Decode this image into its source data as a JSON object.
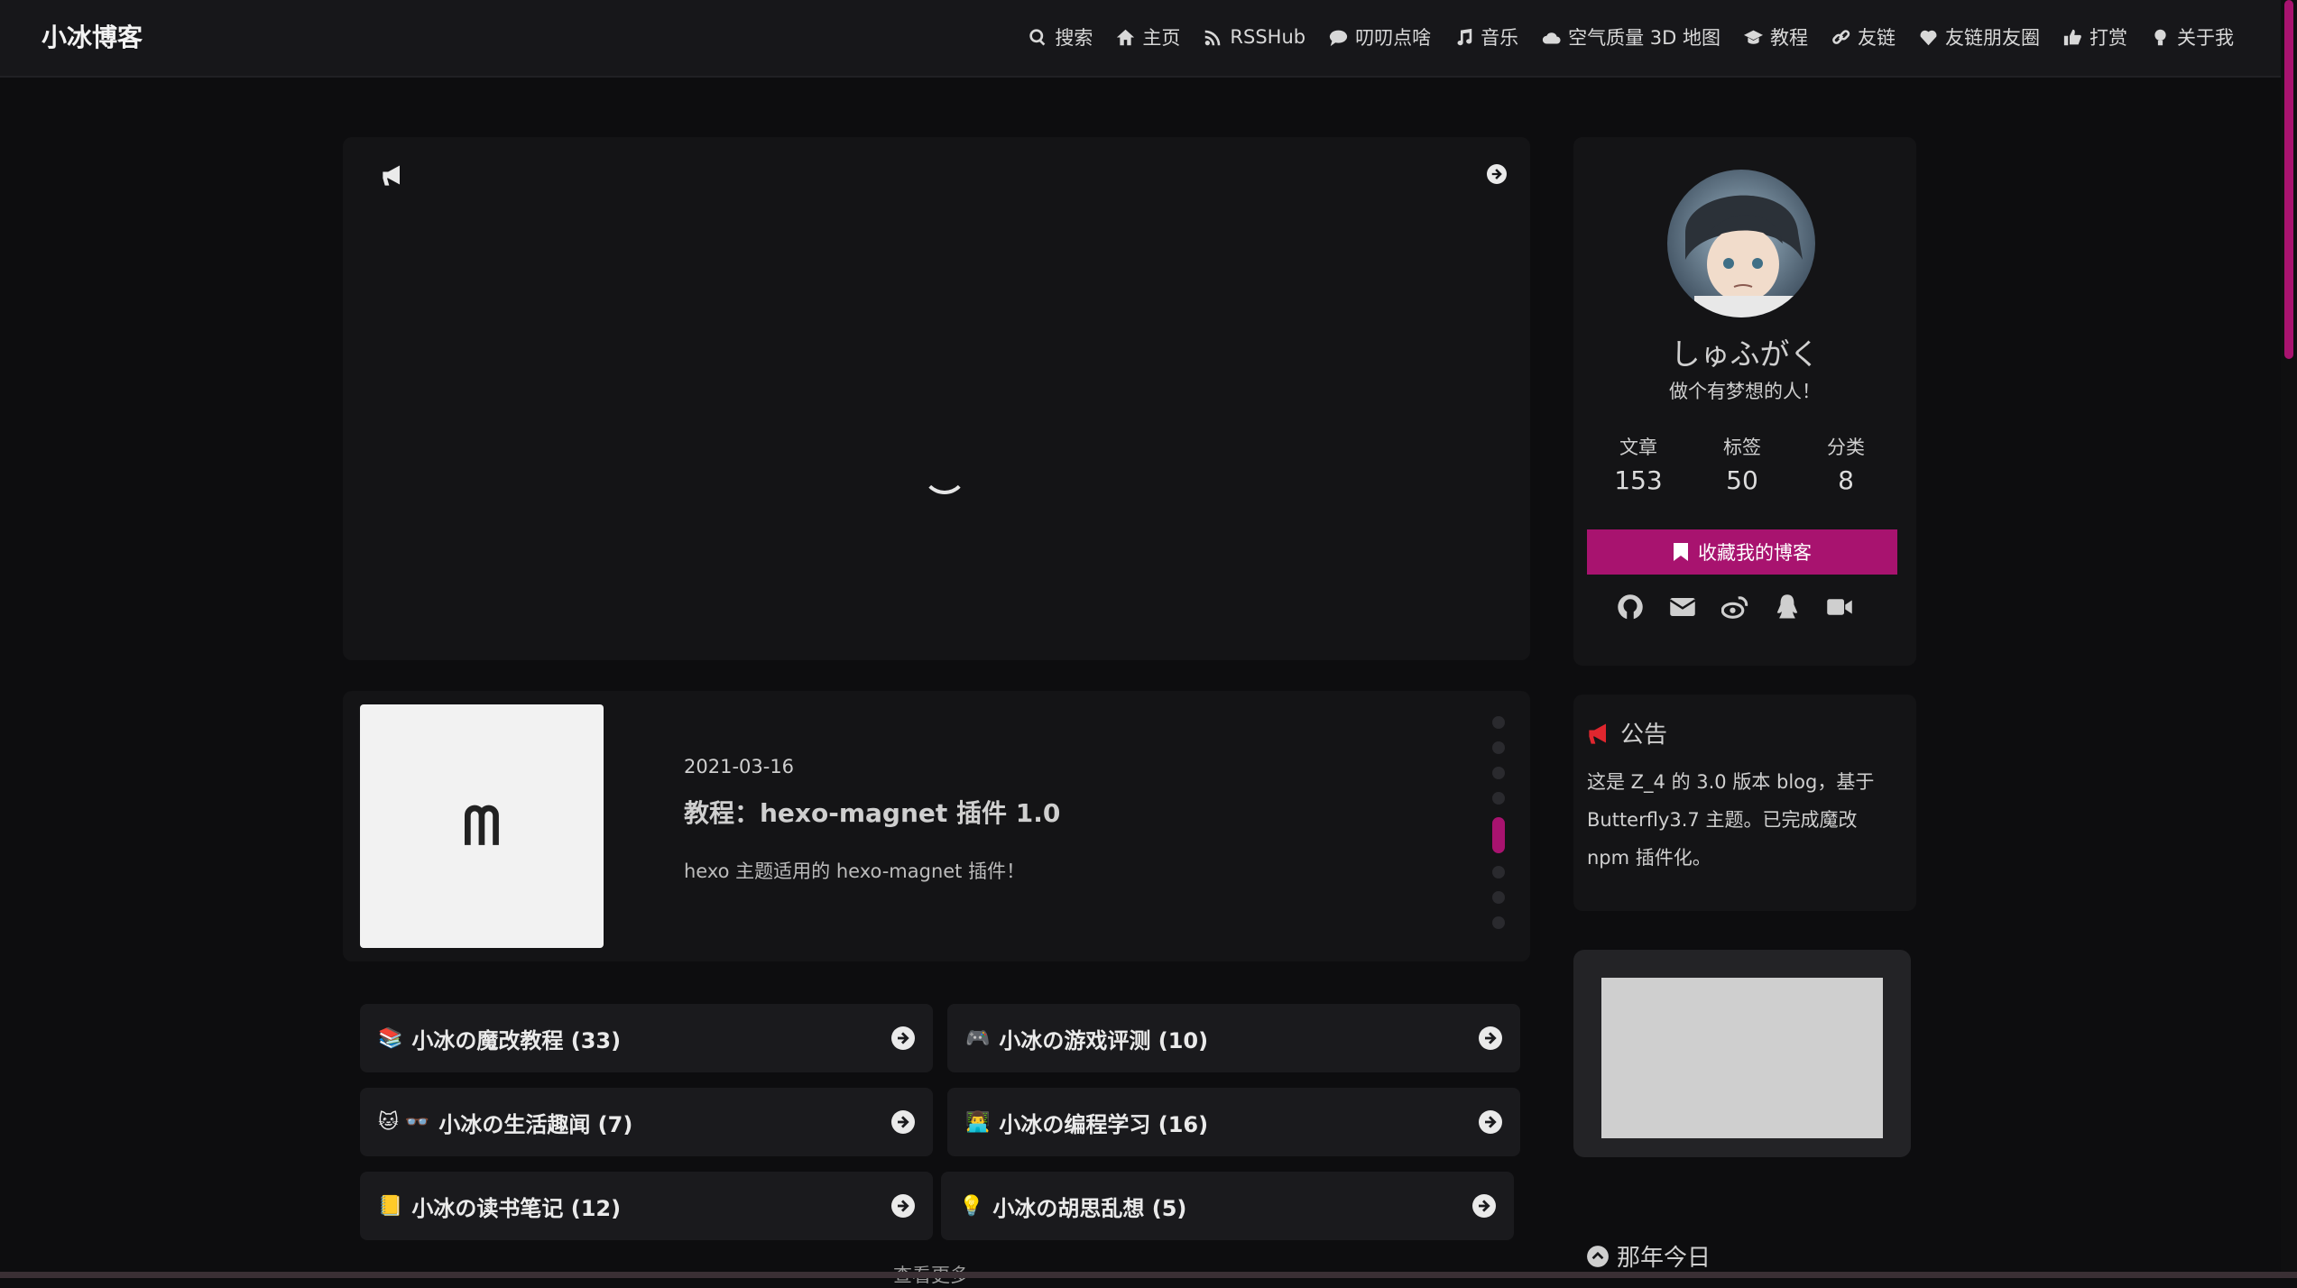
{
  "site": {
    "brand": "小冰博客"
  },
  "nav": {
    "items": [
      {
        "label": "搜索",
        "icon": "search-icon"
      },
      {
        "label": "主页",
        "icon": "home-icon"
      },
      {
        "label": "RSSHub",
        "icon": "rss-icon"
      },
      {
        "label": "叨叨点啥",
        "icon": "comment-icon"
      },
      {
        "label": "音乐",
        "icon": "music-icon"
      },
      {
        "label": "空气质量 3D 地图",
        "icon": "cloud-icon"
      },
      {
        "label": "教程",
        "icon": "graduation-cap-icon"
      },
      {
        "label": "友链",
        "icon": "link-icon"
      },
      {
        "label": "友链朋友圈",
        "icon": "heart-pulse-icon"
      },
      {
        "label": "打赏",
        "icon": "thumbs-up-icon"
      },
      {
        "label": "关于我",
        "icon": "lightbulb-icon"
      }
    ]
  },
  "post": {
    "date": "2021-03-16",
    "title": "教程：hexo-magnet 插件 1.0",
    "desc": "hexo 主题适用的 hexo-magnet 插件！",
    "thumb_glyph": "ᗰ"
  },
  "categories": [
    {
      "emoji": "📚",
      "label": "小冰の魔改教程 (33)"
    },
    {
      "emoji": "🎮",
      "label": "小冰の游戏评测 (10)"
    },
    {
      "emoji": "🐱 👓",
      "label": "小冰の生活趣闻 (7)"
    },
    {
      "emoji": "👨‍💻",
      "label": "小冰の编程学习 (16)"
    },
    {
      "emoji": "📒",
      "label": "小冰の读书笔记 (12)"
    },
    {
      "emoji": "💡",
      "label": "小冰の胡思乱想 (5)"
    }
  ],
  "more_label": "查看更多",
  "profile": {
    "name": "しゅふがく",
    "motto": "做个有梦想的人！",
    "stats": [
      {
        "label": "文章",
        "value": "153"
      },
      {
        "label": "标签",
        "value": "50"
      },
      {
        "label": "分类",
        "value": "8"
      }
    ],
    "follow_button": "收藏我的博客",
    "socials": [
      "github-icon",
      "envelope-icon",
      "weibo-icon",
      "qq-icon",
      "video-icon"
    ]
  },
  "notice": {
    "title": "公告",
    "body": "这是 Z_4 的 3.0 版本 blog，基于 Butterfly3.7 主题。已完成魔改 npm 插件化。"
  },
  "history": {
    "title": "那年今日"
  },
  "colors": {
    "accent": "#a8136f",
    "background": "#0d0d0f",
    "card": "#141416"
  }
}
